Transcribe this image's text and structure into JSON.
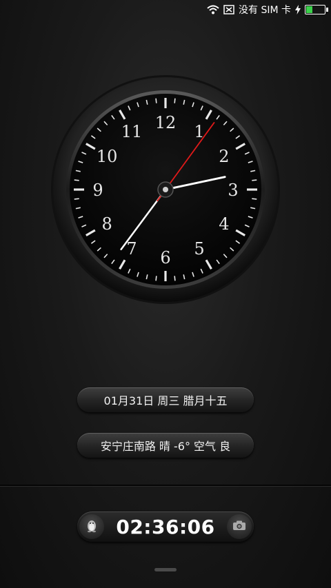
{
  "status_bar": {
    "sim_text": "没有 SIM 卡",
    "battery_level": 0.35,
    "icons": [
      "wifi-icon",
      "no-sim-icon",
      "charging-icon",
      "battery-icon"
    ]
  },
  "clock": {
    "numerals": [
      "12",
      "1",
      "2",
      "3",
      "4",
      "5",
      "6",
      "7",
      "8",
      "9",
      "10",
      "11"
    ],
    "time_shown": {
      "hour": 2,
      "minute": 36,
      "second": 6
    }
  },
  "date_pill": {
    "text": "01月31日 周三 腊月十五"
  },
  "weather_pill": {
    "text": "安宁庄南路 晴 -6° 空气 良"
  },
  "lock_bar": {
    "time": "02:36:06",
    "left_icon": "penguin-icon",
    "right_icon": "camera-icon"
  },
  "colors": {
    "battery_fill": "#3bd14b",
    "second_hand": "#e01a1a"
  }
}
